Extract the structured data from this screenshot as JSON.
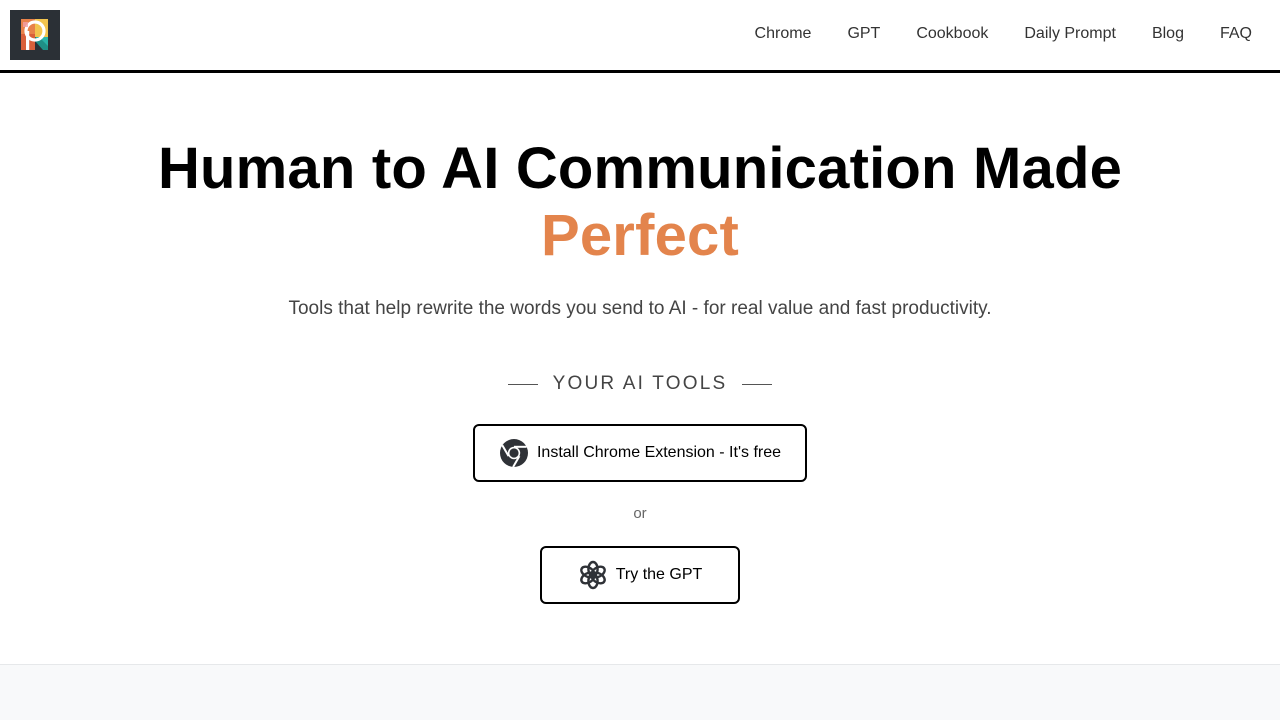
{
  "brand": {
    "logo_icon": "prompt-perfect-logo-icon"
  },
  "nav": {
    "items": [
      {
        "label": "Chrome"
      },
      {
        "label": "GPT"
      },
      {
        "label": "Cookbook"
      },
      {
        "label": "Daily Prompt"
      },
      {
        "label": "Blog"
      },
      {
        "label": "FAQ"
      }
    ]
  },
  "hero": {
    "headline_main": "Human to AI Communication Made",
    "headline_accent": "Perfect",
    "accent_color": "#e3844c",
    "subtitle": "Tools that help rewrite the words you send to AI - for real value and fast productivity."
  },
  "tools": {
    "section_label": "YOUR AI TOOLS",
    "chrome_button_label": "Install Chrome Extension - It's free",
    "chrome_icon": "chrome-icon",
    "separator": "or",
    "gpt_button_label": "Try the GPT",
    "gpt_icon": "openai-icon"
  }
}
